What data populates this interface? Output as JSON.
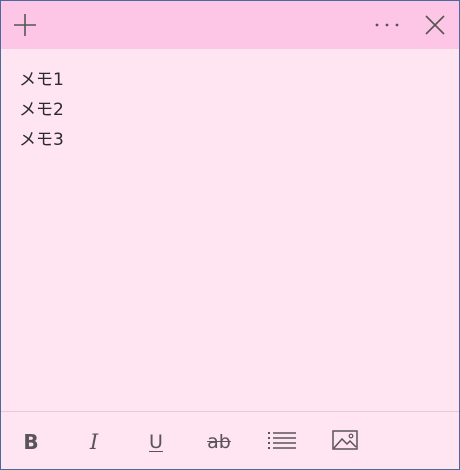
{
  "titlebar": {
    "add_icon": "plus-icon",
    "menu_icon": "more-horizontal-icon",
    "close_icon": "close-icon"
  },
  "note": {
    "lines": [
      "メモ1",
      "メモ2",
      "メモ3"
    ]
  },
  "toolbar": {
    "bold_label": "B",
    "italic_label": "I",
    "underline_label": "U",
    "strike_label": "ab",
    "list_icon": "bulleted-list-icon",
    "image_icon": "image-icon"
  },
  "colors": {
    "titlebar": "#fec6e6",
    "body": "#ffe4f1",
    "border": "#4a6a9c"
  }
}
